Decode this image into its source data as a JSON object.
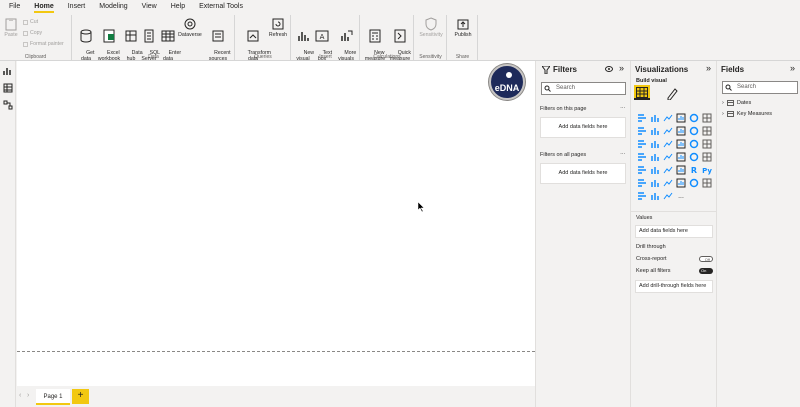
{
  "menu": {
    "tabs": [
      {
        "label": "File"
      },
      {
        "label": "Home"
      },
      {
        "label": "Insert"
      },
      {
        "label": "Modeling"
      },
      {
        "label": "View"
      },
      {
        "label": "Help"
      },
      {
        "label": "External Tools"
      }
    ]
  },
  "ribbon": {
    "clipboard": {
      "label": "Clipboard",
      "paste": "Paste",
      "cut": "Cut",
      "copy": "Copy",
      "format_painter": "Format painter"
    },
    "data": {
      "label": "Data",
      "get_data": "Get\ndata",
      "excel": "Excel\nworkbook",
      "data_hub": "Data\nhub",
      "sql": "SQL\nServer",
      "enter_data": "Enter\ndata",
      "dataverse": "Dataverse",
      "recent": "Recent\nsources"
    },
    "queries": {
      "label": "Queries",
      "transform": "Transform\ndata",
      "refresh": "Refresh"
    },
    "insert": {
      "label": "Insert",
      "new_visual": "New\nvisual",
      "text_box": "Text\nbox",
      "more_visuals": "More\nvisuals"
    },
    "calculations": {
      "label": "Calculations",
      "new_measure": "New\nmeasure",
      "quick_measure": "Quick\nmeasure"
    },
    "sensitivity": {
      "label": "Sensitivity",
      "sensitivity": "Sensitivity"
    },
    "share": {
      "label": "Share",
      "publish": "Publish"
    }
  },
  "canvas": {
    "logo_text": "eDNA"
  },
  "pages": {
    "tabs": [
      {
        "label": "Page 1"
      }
    ],
    "add": "+"
  },
  "filters": {
    "title": "Filters",
    "search_placeholder": "Search",
    "this_page": "Filters on this page",
    "all_pages": "Filters on all pages",
    "add_here": "Add data fields here"
  },
  "visualizations": {
    "title": "Visualizations",
    "build_visual": "Build visual",
    "values_label": "Values",
    "values_add": "Add data fields here",
    "drill_through": "Drill through",
    "cross_report": "Cross-report",
    "cross_report_state": "Off",
    "keep_all_filters": "Keep all filters",
    "keep_all_filters_state": "On",
    "drill_add": "Add drill-through fields here",
    "more": "..."
  },
  "fields": {
    "title": "Fields",
    "search_placeholder": "Search",
    "items": [
      {
        "label": "Dates"
      },
      {
        "label": "Key Measures"
      }
    ]
  },
  "colors": {
    "accent": "#f2c811",
    "navy": "#1e2a5a",
    "blue": "#118dff"
  }
}
